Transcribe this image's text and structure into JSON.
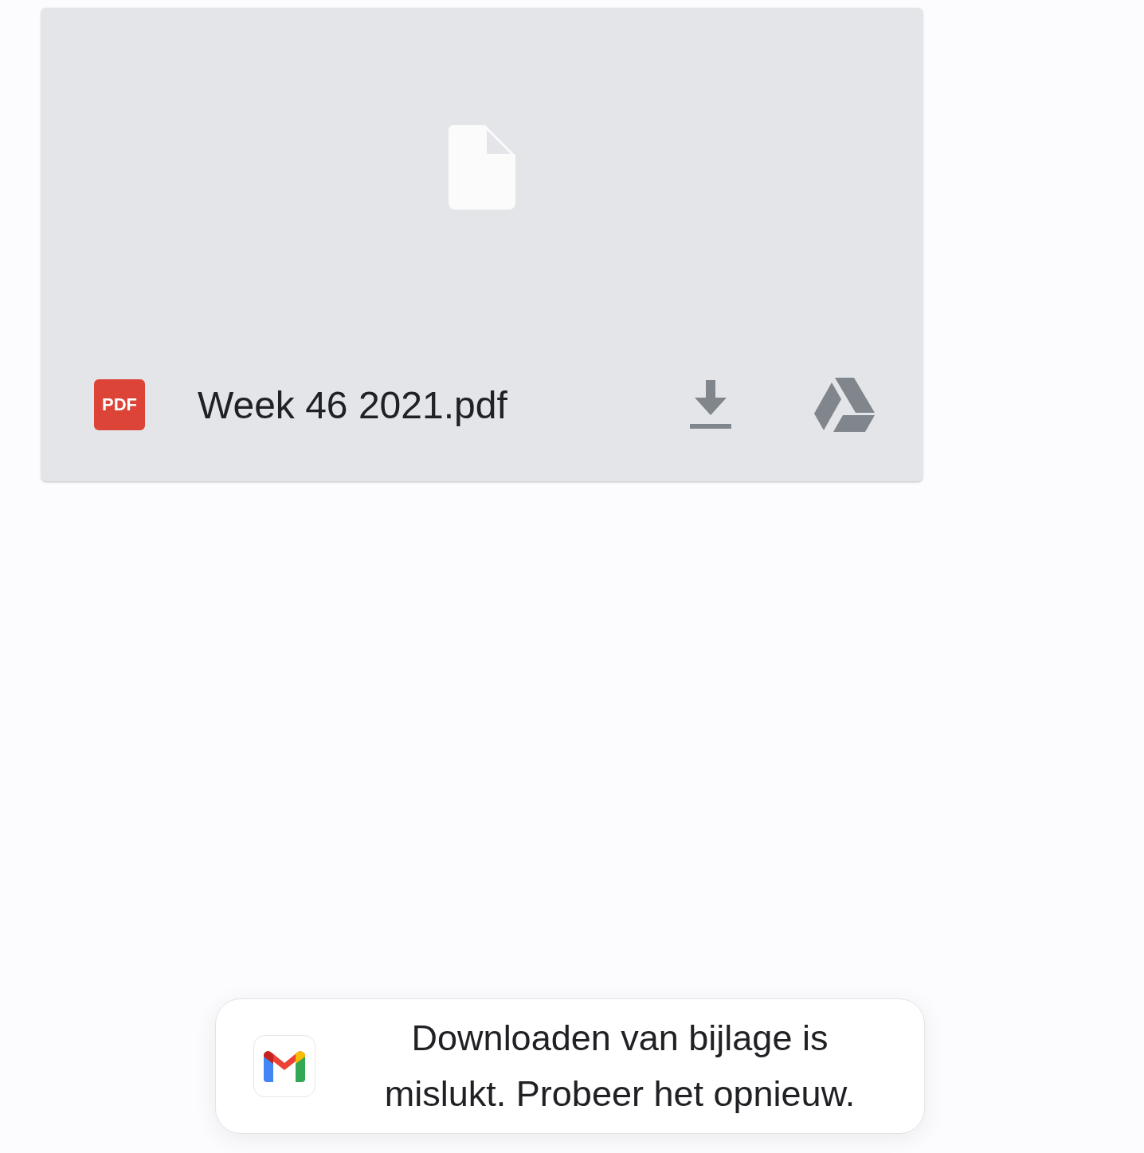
{
  "attachment": {
    "badge": "PDF",
    "file_name": "Week 46 2021.pdf"
  },
  "snackbar": {
    "message": "Downloaden van bijlage is mislukt. Probeer het opnieuw."
  }
}
